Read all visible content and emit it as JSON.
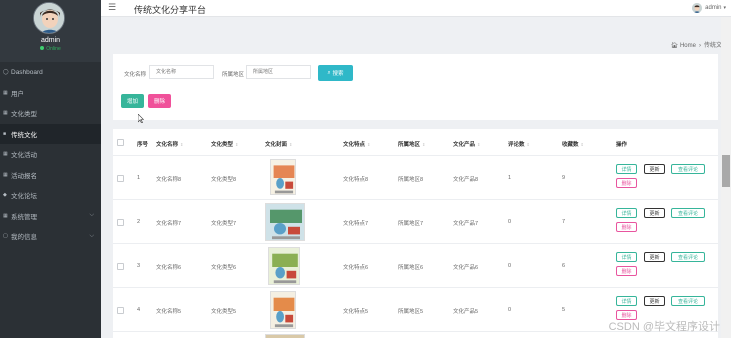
{
  "app": {
    "title": "传统文化分享平台",
    "user": "admin"
  },
  "sidebar": {
    "username": "admin",
    "status": "Online",
    "items": [
      {
        "label": "Dashboard",
        "icon": "dashboard-icon",
        "glyph": "◯",
        "has_children": false
      },
      {
        "label": "用户",
        "icon": "grid-icon",
        "glyph": "▦",
        "has_children": false
      },
      {
        "label": "文化类型",
        "icon": "grid-icon",
        "glyph": "▦",
        "has_children": false
      },
      {
        "label": "传统文化",
        "icon": "book-icon",
        "glyph": "■",
        "has_children": false,
        "active": true
      },
      {
        "label": "文化活动",
        "icon": "grid-icon",
        "glyph": "▦",
        "has_children": false
      },
      {
        "label": "活动报名",
        "icon": "grid-icon",
        "glyph": "▦",
        "has_children": false
      },
      {
        "label": "文化论坛",
        "icon": "pin-icon",
        "glyph": "◆",
        "has_children": false
      },
      {
        "label": "系统管理",
        "icon": "grid-icon",
        "glyph": "▦",
        "has_children": true
      },
      {
        "label": "我的信息",
        "icon": "list-icon",
        "glyph": "▢",
        "has_children": true
      }
    ]
  },
  "breadcrumb": {
    "home": "Home",
    "current": "传统文化"
  },
  "search": {
    "name_label": "文化名称",
    "name_placeholder": "文化名称",
    "region_label": "所属地区",
    "region_placeholder": "所属地区",
    "search_button": "搜索",
    "add_button": "增加",
    "delete_button": "删除"
  },
  "table": {
    "headers": [
      "序号",
      "文化名称",
      "文化类型",
      "文化封面",
      "文化特点",
      "所属地区",
      "文化产品",
      "评论数",
      "收藏数",
      "操作"
    ],
    "rows": [
      {
        "index": "1",
        "name": "文化名称8",
        "type": "文化类型8",
        "feature": "文化特点8",
        "region": "所属地区8",
        "product": "文化产品8",
        "comments": "1",
        "favorites": "9"
      },
      {
        "index": "2",
        "name": "文化名称7",
        "type": "文化类型7",
        "feature": "文化特点7",
        "region": "所属地区7",
        "product": "文化产品7",
        "comments": "0",
        "favorites": "7"
      },
      {
        "index": "3",
        "name": "文化名称6",
        "type": "文化类型6",
        "feature": "文化特点6",
        "region": "所属地区6",
        "product": "文化产品6",
        "comments": "0",
        "favorites": "6"
      },
      {
        "index": "4",
        "name": "文化名称5",
        "type": "文化类型5",
        "feature": "文化特点5",
        "region": "所属地区5",
        "product": "文化产品5",
        "comments": "0",
        "favorites": "5"
      }
    ],
    "actions": {
      "detail": "详情",
      "update": "更新",
      "review": "查看评论",
      "delete": "删除"
    }
  },
  "watermark": "CSDN @毕文程序设计",
  "colors": {
    "sidebar": "#2b3035",
    "search": "#2fb8c8",
    "add": "#36b59a",
    "delete": "#f0519a",
    "online": "#3ed06f"
  }
}
